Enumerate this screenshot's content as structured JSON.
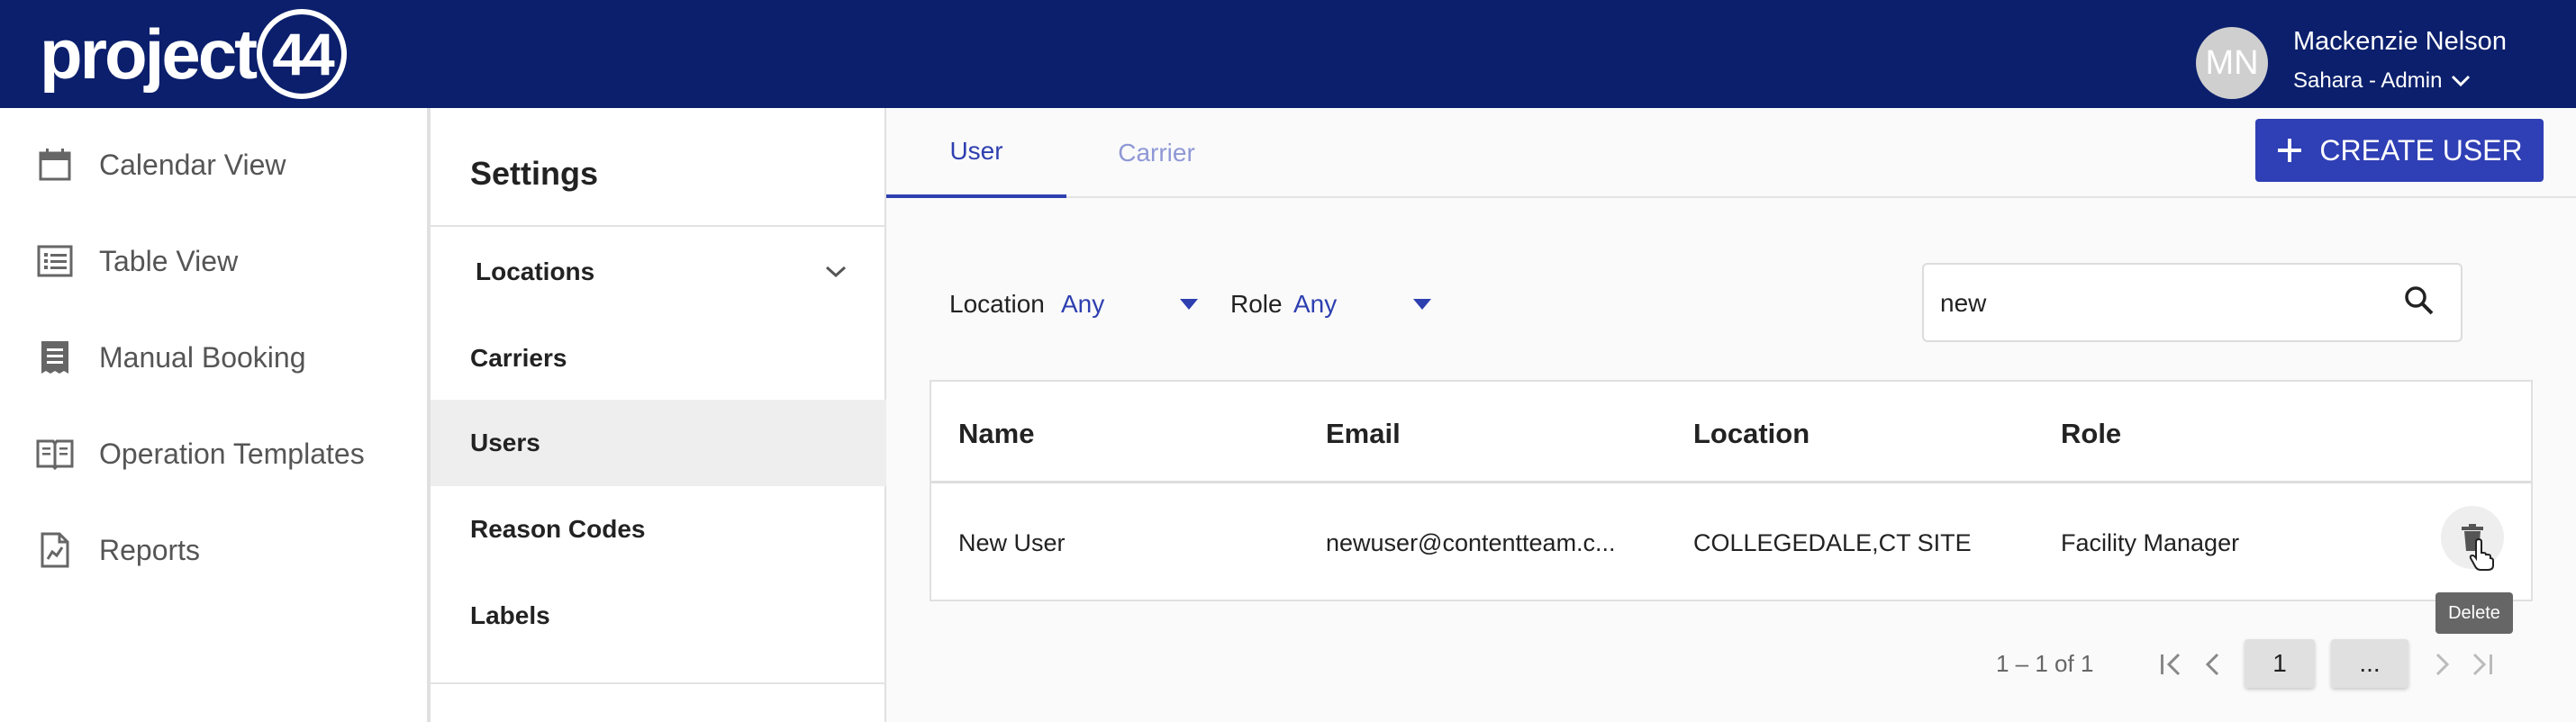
{
  "header": {
    "logo_text": "project",
    "logo_number": "44",
    "avatar_initials": "MN",
    "user_name": "Mackenzie Nelson",
    "user_role": "Sahara - Admin"
  },
  "sidebar": {
    "items": [
      {
        "label": "Calendar View",
        "icon": "calendar-icon"
      },
      {
        "label": "Table View",
        "icon": "list-icon"
      },
      {
        "label": "Manual Booking",
        "icon": "receipt-icon"
      },
      {
        "label": "Operation Templates",
        "icon": "book-icon"
      },
      {
        "label": "Reports",
        "icon": "report-icon"
      }
    ]
  },
  "settings": {
    "title": "Settings",
    "items": [
      {
        "label": "Locations",
        "expandable": true
      },
      {
        "label": "Carriers"
      },
      {
        "label": "Users",
        "active": true
      },
      {
        "label": "Reason Codes"
      },
      {
        "label": "Labels"
      }
    ]
  },
  "main": {
    "tabs": [
      {
        "label": "User",
        "active": true
      },
      {
        "label": "Carrier",
        "active": false
      }
    ],
    "create_button": "CREATE USER",
    "filters": {
      "location_label": "Location",
      "location_value": "Any",
      "role_label": "Role",
      "role_value": "Any"
    },
    "search": {
      "value": "new"
    },
    "table": {
      "columns": [
        "Name",
        "Email",
        "Location",
        "Role"
      ],
      "rows": [
        {
          "name": "New User",
          "email": "newuser@contentteam.c...",
          "location": "COLLEGEDALE,CT SITE",
          "role": "Facility Manager"
        }
      ]
    },
    "tooltip": "Delete",
    "pagination": {
      "range": "1 – 1 of 1",
      "current_page": "1",
      "more": "..."
    }
  },
  "colors": {
    "topbar": "#0b1f6c",
    "accent": "#2e3fb0",
    "inactive_tab": "#8f98d6"
  }
}
